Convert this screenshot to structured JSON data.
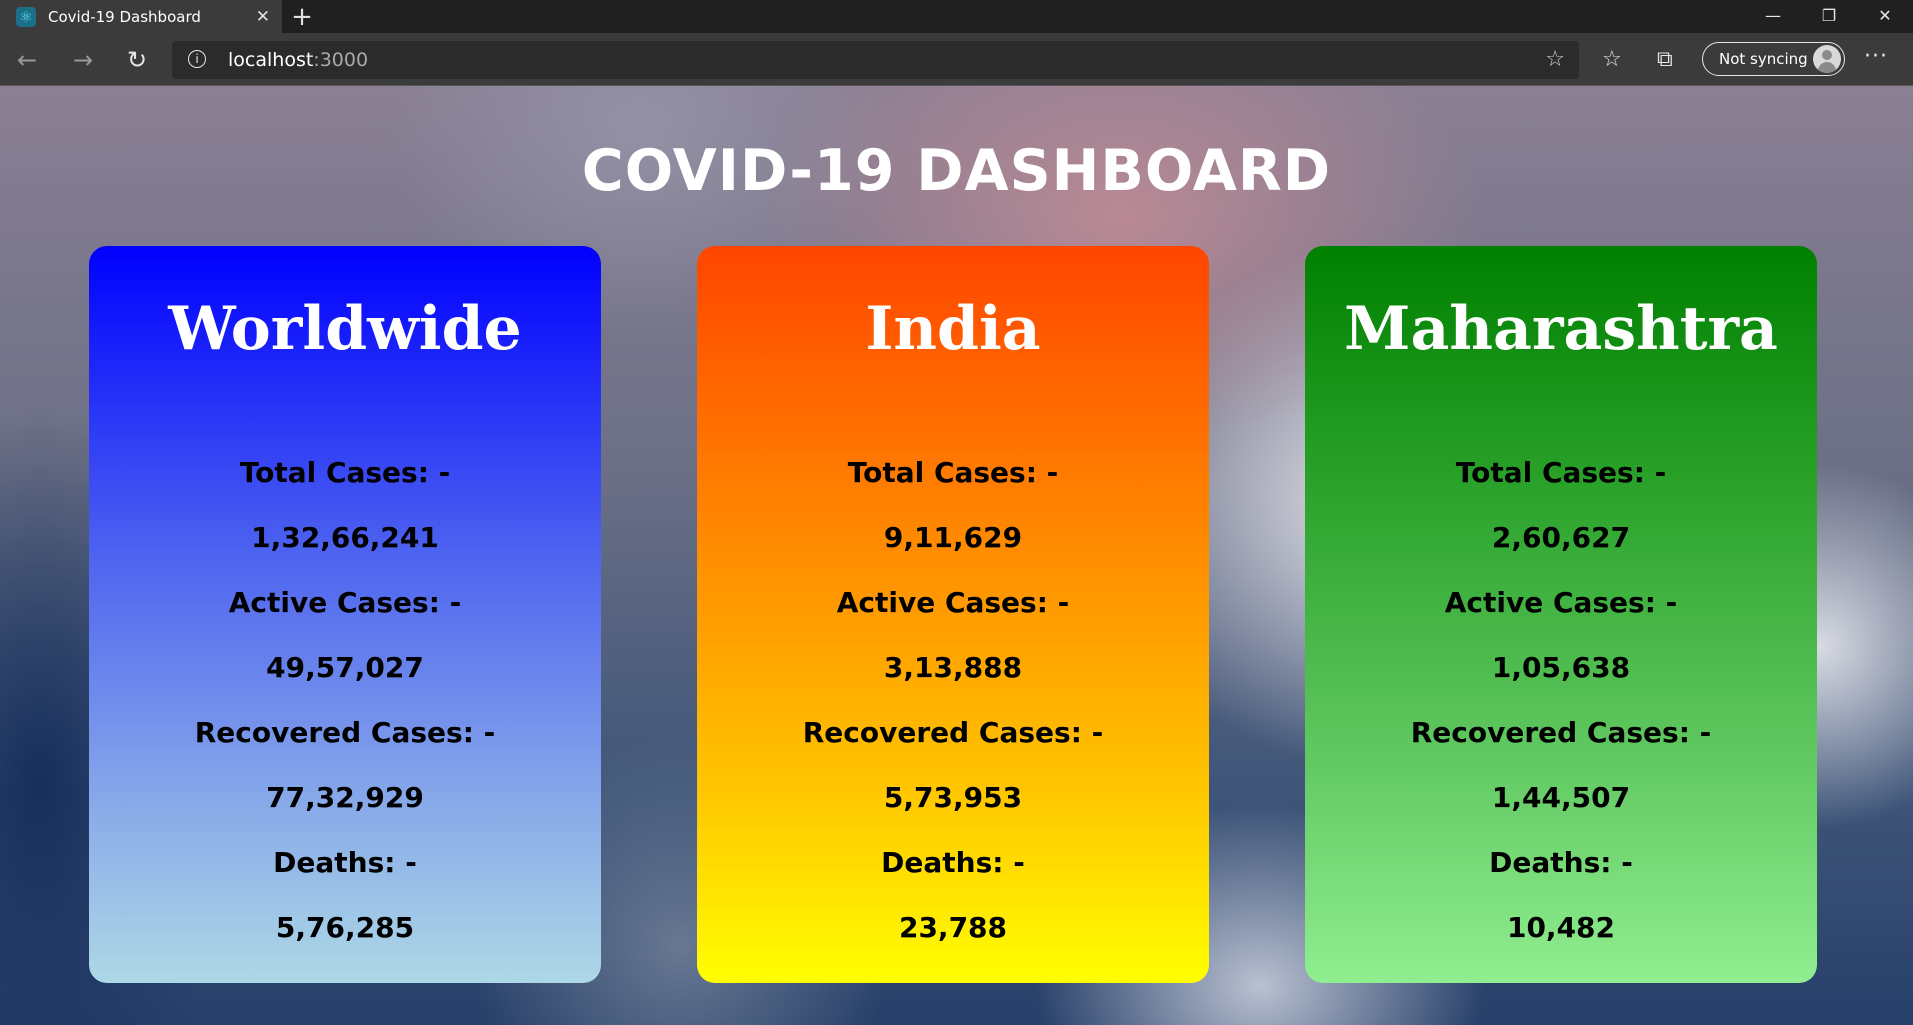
{
  "browser": {
    "tab_title": "Covid-19 Dashboard",
    "url_host": "localhost",
    "url_port": ":3000",
    "profile_status": "Not syncing",
    "icons": [
      "react-favicon-icon",
      "close-icon",
      "plus-icon",
      "back-icon",
      "forward-icon",
      "reload-icon",
      "info-icon",
      "star-icon",
      "favorites-icon",
      "collections-icon",
      "avatar",
      "more-icon"
    ]
  },
  "dashboard": {
    "title": "COVID-19 DASHBOARD",
    "cards": [
      {
        "region": "Worldwide",
        "color_top": "#0000ff",
        "color_bottom": "#add8e6",
        "total_label": "Total Cases: -",
        "total": "1,32,66,241",
        "active_label": "Active Cases: -",
        "active": "49,57,027",
        "recovered_label": "Recovered Cases: -",
        "recovered": "77,32,929",
        "deaths_label": "Deaths: -",
        "deaths": "5,76,285"
      },
      {
        "region": "India",
        "color_top": "#ff4500",
        "color_bottom": "#ffff00",
        "total_label": "Total Cases: -",
        "total": "9,11,629",
        "active_label": "Active Cases: -",
        "active": "3,13,888",
        "recovered_label": "Recovered Cases: -",
        "recovered": "5,73,953",
        "deaths_label": "Deaths: -",
        "deaths": "23,788"
      },
      {
        "region": "Maharashtra",
        "color_top": "#008000",
        "color_bottom": "#90ee90",
        "total_label": "Total Cases: -",
        "total": "2,60,627",
        "active_label": "Active Cases: -",
        "active": "1,05,638",
        "recovered_label": "Recovered Cases: -",
        "recovered": "1,44,507",
        "deaths_label": "Deaths: -",
        "deaths": "10,482"
      }
    ]
  }
}
